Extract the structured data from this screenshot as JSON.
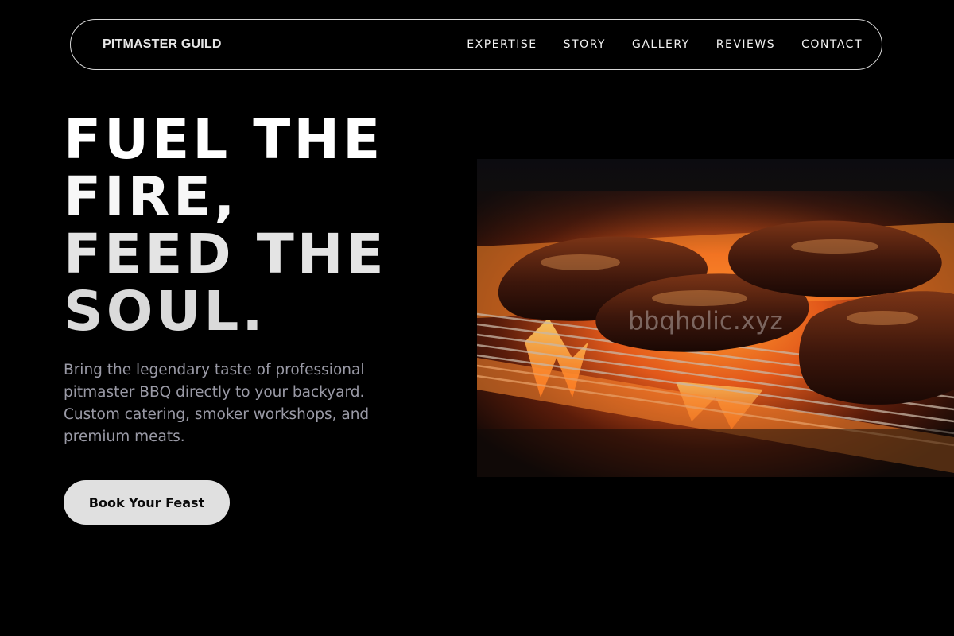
{
  "header": {
    "brand": "PITMASTER GUILD",
    "nav": [
      {
        "label": "EXPERTISE"
      },
      {
        "label": "STORY"
      },
      {
        "label": "GALLERY"
      },
      {
        "label": "REVIEWS"
      },
      {
        "label": "CONTACT"
      }
    ]
  },
  "hero": {
    "headline_lines": [
      "FUEL THE",
      "FIRE,",
      "FEED THE",
      "SOUL."
    ],
    "subtitle": "Bring the legendary taste of professional pitmaster BBQ directly to your backyard. Custom catering, smoker workshops, and premium meats.",
    "cta_label": "Book Your Feast",
    "image": {
      "watermark": "bbqholic.xyz"
    }
  },
  "colors": {
    "background": "#000000",
    "text_primary": "#ffffff",
    "text_muted": "#9a9aa6",
    "button_bg": "#e0e0e0",
    "fire": "#ff7a1a"
  }
}
